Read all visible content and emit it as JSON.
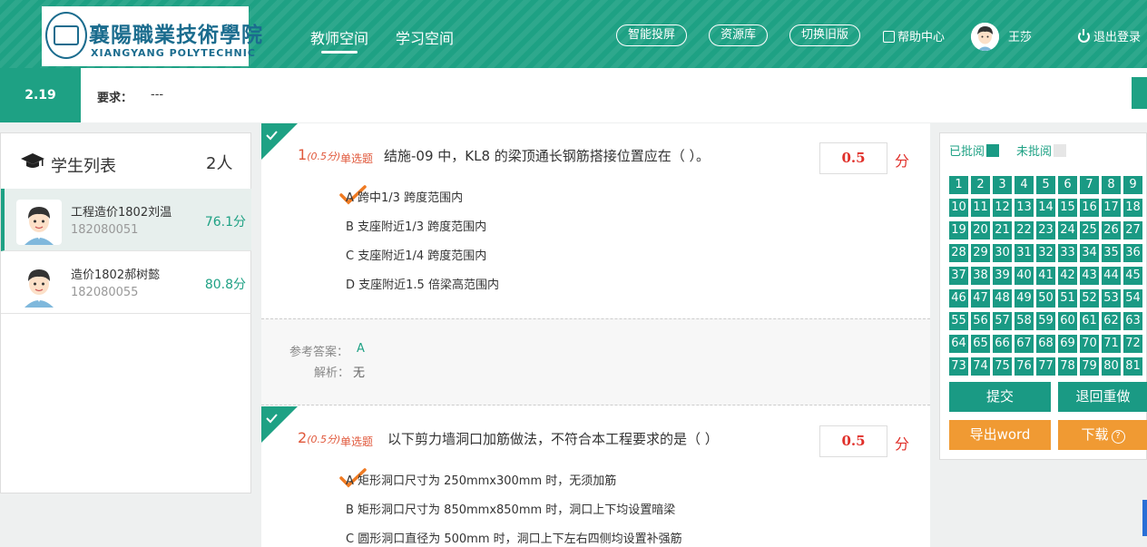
{
  "header": {
    "logo_cn": "襄陽職業技術學院",
    "logo_en": "XIANGYANG  POLYTECHNIC",
    "nav": [
      {
        "label": "教师空间",
        "active": true
      },
      {
        "label": "学习空间",
        "active": false
      }
    ],
    "pills": [
      "智能投屏",
      "资源库",
      "切换旧版"
    ],
    "help_label": "帮助中心",
    "user_name": "王莎",
    "logout_label": "退出登录"
  },
  "requirement": {
    "badge": "2.19",
    "label": "要求：",
    "value": "---"
  },
  "student_panel": {
    "title": "学生列表",
    "count": "2人",
    "students": [
      {
        "name": "工程造价1802刘温",
        "id": "182080051",
        "score": "76.1分",
        "active": true
      },
      {
        "name": "造价1802郝树懿",
        "id": "182080055",
        "score": "80.8分",
        "active": false
      }
    ]
  },
  "questions": [
    {
      "number": "1",
      "points": "(0.5分)",
      "type": "单选题",
      "title": "结施-09 中，KL8 的梁顶通长钢筋搭接位置应在（ ）。",
      "score": "0.5",
      "unit": "分",
      "options": [
        "A 跨中1/3 跨度范围内",
        "B 支座附近1/3 跨度范围内",
        "C 支座附近1/4 跨度范围内",
        "D 支座附近1.5 倍梁高范围内"
      ],
      "answer_label": "参考答案：",
      "answer": "A",
      "explain_label": "解析：",
      "explain": "无"
    },
    {
      "number": "2",
      "points": "(0.5分)",
      "type": "单选题",
      "title": "以下剪力墙洞口加筋做法，不符合本工程要求的是（     ）",
      "score": "0.5",
      "unit": "分",
      "options": [
        "A 矩形洞口尺寸为 250mmx300mm 时，无须加筋",
        "B 矩形洞口尺寸为 850mmx850mm 时，洞口上下均设置暗梁",
        "C 圆形洞口直径为 500mm 时，洞口上下左右四侧均设置补强筋"
      ]
    }
  ],
  "review_panel": {
    "reviewed_label": "已批阅",
    "unreviewed_label": "未批阅",
    "reviewed_color": "#1a9a84",
    "unreviewed_color": "#e6e6e6",
    "numbers": [
      "1",
      "2",
      "3",
      "4",
      "5",
      "6",
      "7",
      "8",
      "9",
      "10",
      "11",
      "12",
      "13",
      "14",
      "15",
      "16",
      "17",
      "18",
      "19",
      "20",
      "21",
      "22",
      "23",
      "24",
      "25",
      "26",
      "27",
      "28",
      "29",
      "30",
      "31",
      "32",
      "33",
      "34",
      "35",
      "36",
      "37",
      "38",
      "39",
      "40",
      "41",
      "42",
      "43",
      "44",
      "45",
      "46",
      "47",
      "48",
      "49",
      "50",
      "51",
      "52",
      "53",
      "54",
      "55",
      "56",
      "57",
      "58",
      "59",
      "60",
      "61",
      "62",
      "63",
      "64",
      "65",
      "66",
      "67",
      "68",
      "69",
      "70",
      "71",
      "72",
      "73",
      "74",
      "75",
      "76",
      "77",
      "78",
      "79",
      "80",
      "81"
    ],
    "submit_label": "提交",
    "redo_label": "退回重做",
    "export_label": "导出word",
    "download_label": "下载"
  },
  "colors": {
    "brand": "#1ea184",
    "accent_red": "#e0302a",
    "orange": "#f09a33"
  }
}
